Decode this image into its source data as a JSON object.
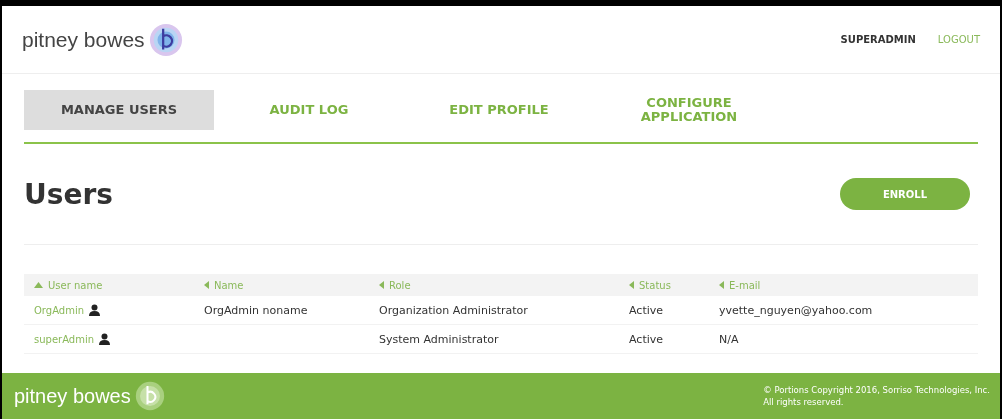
{
  "header": {
    "brand": "pitney bowes",
    "user": "SUPERADMIN",
    "logout": "LOGOUT"
  },
  "tabs": [
    {
      "label": "MANAGE USERS",
      "selected": true
    },
    {
      "label": "AUDIT LOG",
      "selected": false
    },
    {
      "label": "EDIT PROFILE",
      "selected": false
    },
    {
      "label": "CONFIGURE APPLICATION",
      "selected": false
    }
  ],
  "page": {
    "title": "Users",
    "action": "ENROLL"
  },
  "table": {
    "columns": [
      {
        "label": "User name",
        "sorted": true
      },
      {
        "label": "Name",
        "sorted": false
      },
      {
        "label": "Role",
        "sorted": false
      },
      {
        "label": "Status",
        "sorted": false
      },
      {
        "label": "E-mail",
        "sorted": false
      }
    ],
    "rows": [
      {
        "user_name": "OrgAdmin",
        "name": "OrgAdmin noname",
        "role": "Organization Administrator",
        "status": "Active",
        "email": "yvette_nguyen@yahoo.com"
      },
      {
        "user_name": "superAdmin",
        "name": "",
        "role": "System Administrator",
        "status": "Active",
        "email": "N/A"
      }
    ]
  },
  "footer": {
    "brand": "pitney bowes",
    "copyright": "© Portions Copyright 2016, Sorriso Technologies, Inc.",
    "rights": "All rights reserved."
  }
}
